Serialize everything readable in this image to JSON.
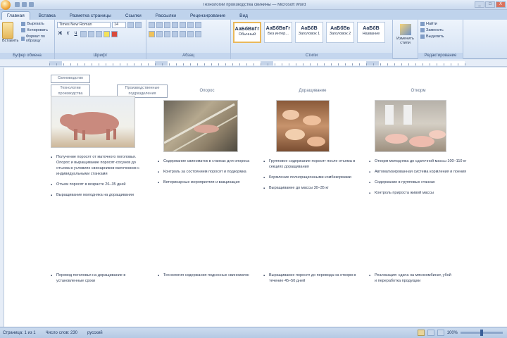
{
  "window": {
    "title": "Технологии производства свинины — Microsoft Word",
    "buttons": [
      "_",
      "□",
      "X"
    ]
  },
  "tabs": [
    "Главная",
    "Вставка",
    "Разметка страницы",
    "Ссылки",
    "Рассылки",
    "Рецензирование",
    "Вид"
  ],
  "ribbon": {
    "clipboard": {
      "paste_label": "Вставить",
      "cut": "Вырезать",
      "copy": "Копировать",
      "format": "Формат по образцу",
      "group": "Буфер обмена"
    },
    "font": {
      "family": "Times New Roman",
      "size": "14",
      "group": "Шрифт",
      "bold": "Ж",
      "italic": "К",
      "underline": "Ч"
    },
    "paragraph": {
      "group": "Абзац"
    },
    "styles": {
      "items": [
        {
          "sample": "АаБбВвГг",
          "name": "Обычный"
        },
        {
          "sample": "АаБбВвГг",
          "name": "Без интер..."
        },
        {
          "sample": "АаБбВ",
          "name": "Заголовок 1"
        },
        {
          "sample": "АаБбВв",
          "name": "Заголовок 2"
        },
        {
          "sample": "АаБбВ",
          "name": "Название"
        }
      ],
      "change_label": "Изменить стили",
      "group": "Стили"
    },
    "editing": {
      "find": "Найти",
      "replace": "Заменить",
      "select": "Выделить",
      "group": "Редактирование"
    }
  },
  "document": {
    "header_boxes": [
      "Свиноводство",
      "Технологии производства"
    ],
    "header_box2": "Производственные подразделения",
    "columns": [
      {
        "head": "",
        "photo": "pig-photo",
        "bullets": [
          "Получение поросят от маточного поголовья. Опорос и выращивание поросят-сосунов до отъема в условиях свинарников-маточников с индивидуальными станками",
          "Отъем поросят в возрасте 26–35 дней",
          "Выращивание молодняка на доращивании"
        ],
        "note": "Перевод поголовья на доращивание в установленные сроки"
      },
      {
        "head": "Опорос",
        "photo": "pen-photo",
        "bullets": [
          "Содержание свиноматок в станках для опороса",
          "Контроль за состоянием поросят и подкормка",
          "Ветеринарные мероприятия и вакцинация"
        ],
        "note": "Технология содержания подсосных свиноматок"
      },
      {
        "head": "Доращивание",
        "photo": "piglets-photo",
        "bullets": [
          "Групповое содержание поросят после отъема в секциях доращивания",
          "Кормление полнорационными комбикормами",
          "Выращивание до массы 30–35 кг"
        ],
        "note": "Выращивание поросят до перевода на откорм в течение 45–50 дней"
      },
      {
        "head": "Откорм",
        "photo": "feeding-photo",
        "bullets": [
          "Откорм молодняка до сдаточной массы 100–110 кг",
          "Автоматизированная система кормления и поения",
          "Содержание в групповых станках",
          "Контроль прироста живой массы"
        ],
        "note": "Реализация: сдача на мясокомбинат, убой и переработка продукции"
      }
    ]
  },
  "status": {
    "page": "Страница: 1 из 1",
    "words": "Число слов: 230",
    "lang": "русский",
    "zoom": "100%"
  }
}
